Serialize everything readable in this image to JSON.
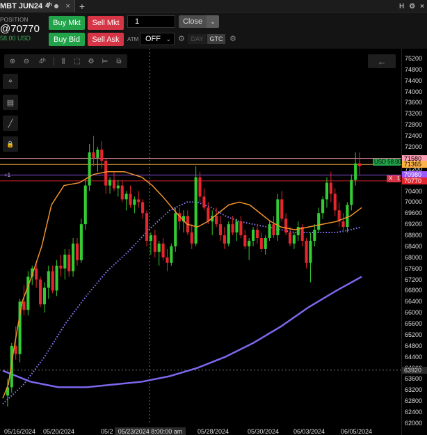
{
  "tab": {
    "title": "MBT JUN24",
    "timeframe": "4ʰ",
    "close_glyph": "×",
    "add_glyph": "+"
  },
  "window_controls": {
    "h_label": "H",
    "gear_glyph": "⚙",
    "close_glyph": "×"
  },
  "position": {
    "label": "POSITION",
    "price": "@70770",
    "pnl": "58.00 USD"
  },
  "order_buttons": {
    "buy_mkt": "Buy Mkt",
    "sell_mkt": "Sell Mkt",
    "buy_bid": "Buy Bid",
    "sell_ask": "Sell Ask"
  },
  "quantity": "1",
  "close_button": {
    "label": "Close",
    "dropdown_glyph": "⌄"
  },
  "atm": {
    "label": "ATM",
    "value": "OFF",
    "chevron": "⌄"
  },
  "tif": {
    "day": "DAY",
    "gtc": "GTC"
  },
  "chart_toolbar": {
    "zoom_in": "⊕",
    "zoom_out": "⊖",
    "timeframe": "4ʰ",
    "bars": "⫼",
    "select": "⬚",
    "settings": "⚙",
    "indicators": "⊨",
    "templates": "⧉"
  },
  "side_tools": {
    "crosshair": "⌖",
    "draw": "▤",
    "line": "╱",
    "lock": "🔒"
  },
  "nav_left": "←",
  "labels": {
    "usd_tag": "USD 58.00",
    "x_tag": "X",
    "x_qty": "1",
    "plus_one": "+1",
    "crosshair_date": "05/23/2024 8:00:00 am",
    "crosshair_price": "63920"
  },
  "colors": {
    "candle_up": "#33cc33",
    "candle_down": "#e6262e",
    "ma_fast": "#f0932b",
    "ma_dotted": "#8a7cff",
    "ma_slow": "#7b68ee",
    "line_1580": "#ff9eb5",
    "line_1365": "#ffb347",
    "line_0980": "#9b59ff",
    "line_0770": "#e6262e"
  },
  "chart_data": {
    "type": "candlestick",
    "instrument": "MBT JUN24",
    "timeframe": "4h",
    "ylim": [
      62000,
      75400
    ],
    "price_ticks": [
      75200,
      74800,
      74400,
      74000,
      73600,
      73200,
      72800,
      72400,
      72000,
      71600,
      71200,
      70800,
      70400,
      70000,
      69600,
      69200,
      68800,
      68400,
      68000,
      67600,
      67200,
      66800,
      66400,
      66000,
      65600,
      65200,
      64800,
      64400,
      64000,
      63600,
      63200,
      62800,
      62400,
      62000
    ],
    "date_ticks": [
      "05/16/2024",
      "05/20/2024",
      "05/2",
      "05/28/2024",
      "05/30/2024",
      "06/03/2024",
      "06/05/2024"
    ],
    "price_lines": [
      {
        "label": "71580",
        "price": 71580,
        "color": "#ff9eb5"
      },
      {
        "label": "71365",
        "price": 71365,
        "color": "#ffb347"
      },
      {
        "label": "70980",
        "price": 70980,
        "color": "#9b59ff"
      },
      {
        "label": "70770",
        "price": 70770,
        "color": "#e6262e"
      }
    ],
    "candles": [
      [
        63000,
        63600,
        62600,
        63300
      ],
      [
        63300,
        64900,
        63100,
        64800
      ],
      [
        64800,
        65500,
        64300,
        64500
      ],
      [
        64500,
        66500,
        64200,
        66400
      ],
      [
        66400,
        67000,
        65900,
        66100
      ],
      [
        66100,
        67500,
        65900,
        67300
      ],
      [
        67300,
        67700,
        67000,
        67600
      ],
      [
        67600,
        67800,
        66900,
        67200
      ],
      [
        67200,
        67300,
        66200,
        66300
      ],
      [
        66300,
        67100,
        66000,
        66900
      ],
      [
        66900,
        67700,
        66500,
        67500
      ],
      [
        67500,
        67700,
        66700,
        66800
      ],
      [
        66800,
        67900,
        66600,
        67700
      ],
      [
        67700,
        68100,
        67300,
        67600
      ],
      [
        67600,
        68300,
        67200,
        68100
      ],
      [
        68100,
        68300,
        67300,
        67500
      ],
      [
        67500,
        68700,
        67300,
        68500
      ],
      [
        68500,
        68700,
        67700,
        67900
      ],
      [
        67900,
        69400,
        67800,
        69200
      ],
      [
        69200,
        70800,
        69000,
        70600
      ],
      [
        70600,
        72100,
        70400,
        71800
      ],
      [
        71800,
        72400,
        71300,
        71600
      ],
      [
        71600,
        72000,
        71100,
        71900
      ],
      [
        71900,
        72200,
        71200,
        71500
      ],
      [
        71500,
        71600,
        70300,
        70600
      ],
      [
        70600,
        70900,
        70300,
        70800
      ],
      [
        70800,
        71100,
        70400,
        70500
      ],
      [
        70500,
        70800,
        70200,
        70600
      ],
      [
        70600,
        70800,
        70000,
        70100
      ],
      [
        70100,
        70400,
        69700,
        70300
      ],
      [
        70300,
        70600,
        69800,
        69900
      ],
      [
        69900,
        70200,
        69600,
        70100
      ],
      [
        70100,
        70400,
        69800,
        70000
      ],
      [
        70000,
        70100,
        69400,
        69600
      ],
      [
        69600,
        69700,
        68400,
        68600
      ],
      [
        68600,
        68900,
        68100,
        68800
      ],
      [
        68800,
        69000,
        68000,
        68200
      ],
      [
        68200,
        68600,
        67700,
        68500
      ],
      [
        68500,
        68700,
        67900,
        68000
      ],
      [
        68000,
        68300,
        67500,
        67800
      ],
      [
        67800,
        68500,
        67700,
        68400
      ],
      [
        68400,
        69800,
        68200,
        69600
      ],
      [
        69600,
        69800,
        69000,
        69300
      ],
      [
        69300,
        69700,
        68900,
        69500
      ],
      [
        69500,
        69700,
        68800,
        68900
      ],
      [
        68900,
        69200,
        68300,
        68500
      ],
      [
        68500,
        71300,
        68400,
        70900
      ],
      [
        70900,
        71100,
        70000,
        70200
      ],
      [
        70200,
        70500,
        69700,
        69800
      ],
      [
        69800,
        70000,
        69200,
        69300
      ],
      [
        69300,
        69700,
        68800,
        69500
      ],
      [
        69500,
        69800,
        69100,
        69200
      ],
      [
        69200,
        69500,
        68600,
        68800
      ],
      [
        68800,
        69100,
        68300,
        68500
      ],
      [
        68500,
        69300,
        68400,
        69200
      ],
      [
        69200,
        69500,
        68800,
        68900
      ],
      [
        68900,
        69400,
        68600,
        69300
      ],
      [
        69300,
        69500,
        68700,
        68800
      ],
      [
        68800,
        69000,
        68300,
        68400
      ],
      [
        68400,
        68700,
        67900,
        68600
      ],
      [
        68600,
        69100,
        68400,
        69000
      ],
      [
        69000,
        69200,
        68500,
        68700
      ],
      [
        68700,
        68900,
        68200,
        68300
      ],
      [
        68300,
        68800,
        68100,
        68700
      ],
      [
        68700,
        69300,
        68600,
        69200
      ],
      [
        69200,
        69500,
        68700,
        68800
      ],
      [
        68800,
        70300,
        68600,
        70100
      ],
      [
        70100,
        70400,
        69300,
        69400
      ],
      [
        69400,
        69600,
        68800,
        68900
      ],
      [
        68900,
        69100,
        68400,
        68500
      ],
      [
        68500,
        68900,
        68300,
        68800
      ],
      [
        68800,
        69300,
        68600,
        69100
      ],
      [
        69100,
        69200,
        68400,
        68600
      ],
      [
        68600,
        68700,
        67600,
        67800
      ],
      [
        67800,
        68900,
        67100,
        68600
      ],
      [
        68600,
        69200,
        68400,
        69000
      ],
      [
        69000,
        69800,
        68900,
        69600
      ],
      [
        69600,
        70200,
        69400,
        70100
      ],
      [
        70100,
        70900,
        69800,
        70700
      ],
      [
        70700,
        71100,
        70000,
        70300
      ],
      [
        70300,
        70500,
        69500,
        69700
      ],
      [
        69700,
        70000,
        69100,
        69300
      ],
      [
        69300,
        69600,
        68900,
        69100
      ],
      [
        69100,
        70000,
        68900,
        69900
      ],
      [
        69900,
        71000,
        69700,
        70800
      ],
      [
        70800,
        71800,
        70600,
        71400
      ],
      [
        71400,
        71800,
        71000,
        71300
      ]
    ],
    "ma_fast": [
      [
        0,
        62900
      ],
      [
        8,
        63400
      ],
      [
        16,
        64700
      ],
      [
        28,
        66400
      ],
      [
        40,
        67200
      ],
      [
        56,
        68400
      ],
      [
        70,
        69900
      ],
      [
        88,
        70600
      ],
      [
        110,
        70700
      ],
      [
        130,
        71000
      ],
      [
        150,
        71100
      ],
      [
        175,
        71100
      ],
      [
        200,
        70900
      ],
      [
        215,
        70600
      ],
      [
        230,
        70200
      ],
      [
        250,
        69600
      ],
      [
        265,
        69200
      ],
      [
        280,
        69100
      ],
      [
        295,
        69300
      ],
      [
        310,
        69600
      ],
      [
        325,
        69900
      ],
      [
        340,
        70000
      ],
      [
        355,
        69900
      ],
      [
        370,
        69600
      ],
      [
        385,
        69300
      ],
      [
        400,
        69100
      ],
      [
        420,
        69000
      ],
      [
        440,
        69100
      ],
      [
        460,
        69200
      ],
      [
        480,
        69300
      ],
      [
        500,
        69500
      ],
      [
        516,
        69800
      ]
    ],
    "ma_dotted": [
      [
        0,
        62700
      ],
      [
        30,
        63400
      ],
      [
        60,
        64400
      ],
      [
        90,
        65600
      ],
      [
        120,
        66600
      ],
      [
        150,
        67500
      ],
      [
        180,
        68200
      ],
      [
        210,
        69000
      ],
      [
        240,
        69700
      ],
      [
        265,
        70000
      ],
      [
        280,
        70000
      ],
      [
        300,
        69800
      ],
      [
        320,
        69500
      ],
      [
        340,
        69300
      ],
      [
        360,
        69200
      ],
      [
        380,
        69100
      ],
      [
        400,
        69000
      ],
      [
        420,
        68900
      ],
      [
        440,
        68900
      ],
      [
        460,
        68900
      ],
      [
        480,
        68900
      ],
      [
        500,
        69000
      ],
      [
        516,
        69100
      ]
    ],
    "ma_slow": [
      [
        0,
        63900
      ],
      [
        40,
        63500
      ],
      [
        80,
        63300
      ],
      [
        120,
        63300
      ],
      [
        160,
        63400
      ],
      [
        200,
        63500
      ],
      [
        240,
        63700
      ],
      [
        280,
        64000
      ],
      [
        320,
        64400
      ],
      [
        360,
        64900
      ],
      [
        400,
        65500
      ],
      [
        440,
        66200
      ],
      [
        480,
        66800
      ],
      [
        516,
        67300
      ]
    ]
  }
}
